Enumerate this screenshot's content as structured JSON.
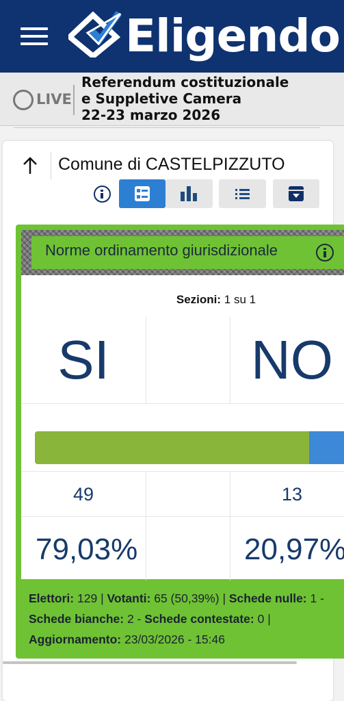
{
  "header": {
    "brand": "Eligendo",
    "menu_icon": "hamburger-menu-icon",
    "logo_icon": "checkmark-ballot-icon",
    "colors": {
      "background": "#0f3270",
      "text": "#ffffff"
    }
  },
  "live": {
    "label": "LIVE",
    "status_icon": "circle-icon"
  },
  "event": {
    "line1": "Referendum costituzionale",
    "line2": "e Suppletive Camera",
    "line3": "22-23 marzo 2026"
  },
  "location": {
    "back_icon": "arrow-up-icon",
    "title": "Comune di CASTELPIZZUTO"
  },
  "toolbar": {
    "info_icon": "info-icon",
    "buttons": [
      {
        "name": "detail-view",
        "icon": "list-detail-icon",
        "active": true
      },
      {
        "name": "chart-view",
        "icon": "bar-chart-icon",
        "active": false
      },
      {
        "name": "list-view",
        "icon": "bulleted-list-icon",
        "active": false
      },
      {
        "name": "archive",
        "icon": "archive-box-icon",
        "active": false
      }
    ],
    "colors": {
      "active": "#2d7fd3",
      "inactive": "#e6e6e6"
    }
  },
  "result": {
    "title": "Norme ordinamento giurisdizionale",
    "info_icon": "info-icon",
    "sections_label": "Sezioni:",
    "sections_value": "1 su 1",
    "options": [
      {
        "label": "SI",
        "votes": "49",
        "percent": "79,03%",
        "share": 79.03,
        "color": "#8ab53b"
      },
      {
        "label": "NO",
        "votes": "13",
        "percent": "20,97%",
        "share": 20.97,
        "color": "#3e88d8"
      }
    ],
    "accent_color": "#6fc234",
    "footer": {
      "elettori_label": "Elettori:",
      "elettori_value": "129",
      "votanti_label": "Votanti:",
      "votanti_value": "65 (50,39%)",
      "nulle_label": "Schede nulle:",
      "nulle_value": "1 -",
      "bianche_label": "Schede bianche:",
      "bianche_value": "2 -",
      "contestate_label": "Schede contestate:",
      "contestate_value": "0",
      "sep": "|",
      "aggiornamento_label": "Aggiornamento:",
      "aggiornamento_value": "23/03/2026 - 15:46"
    }
  }
}
